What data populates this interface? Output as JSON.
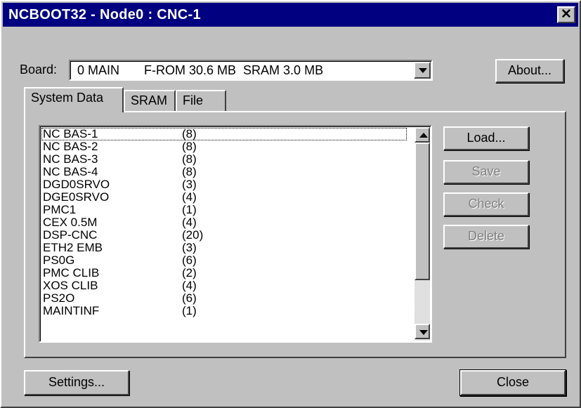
{
  "window": {
    "title": "NCBOOT32 - Node0 : CNC-1"
  },
  "board": {
    "label": "Board:",
    "selected": "0 MAIN       F-ROM 30.6 MB  SRAM 3.0 MB"
  },
  "buttons": {
    "about": "About...",
    "load": "Load...",
    "save": "Save",
    "check": "Check",
    "delete": "Delete",
    "settings": "Settings...",
    "close": "Close"
  },
  "tabs": [
    {
      "label": "System Data",
      "active": true
    },
    {
      "label": "SRAM",
      "active": false
    },
    {
      "label": "File",
      "active": false
    }
  ],
  "list": {
    "items": [
      {
        "name": "NC BAS-1",
        "count": "(8)"
      },
      {
        "name": "NC BAS-2",
        "count": "(8)"
      },
      {
        "name": "NC BAS-3",
        "count": "(8)"
      },
      {
        "name": "NC BAS-4",
        "count": "(8)"
      },
      {
        "name": "DGD0SRVO",
        "count": "(3)"
      },
      {
        "name": "DGE0SRVO",
        "count": "(4)"
      },
      {
        "name": "PMC1",
        "count": "(1)"
      },
      {
        "name": "CEX 0.5M",
        "count": "(4)"
      },
      {
        "name": "DSP-CNC",
        "count": "(20)"
      },
      {
        "name": "ETH2 EMB",
        "count": "(3)"
      },
      {
        "name": "PS0G",
        "count": "(6)"
      },
      {
        "name": "PMC CLIB",
        "count": "(2)"
      },
      {
        "name": "XOS CLIB",
        "count": "(4)"
      },
      {
        "name": "PS2O",
        "count": "(6)"
      },
      {
        "name": "MAINTINF",
        "count": "(1)"
      }
    ]
  },
  "colors": {
    "titlebar": "#000080",
    "face": "#c0c0c0"
  }
}
